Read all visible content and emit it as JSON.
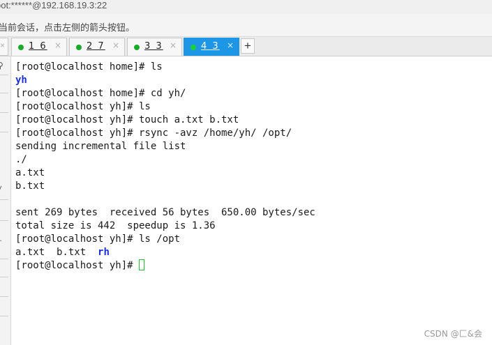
{
  "window": {
    "title": "oot:******@192.168.19.3:22"
  },
  "hint": {
    "text": "当前会话，点击左侧的箭头按钮。"
  },
  "tabs": [
    {
      "label": "1 6",
      "close": "×",
      "status_color": "#1aaa2a"
    },
    {
      "label": "2 7",
      "close": "×",
      "status_color": "#1aaa2a"
    },
    {
      "label": "3 3",
      "close": "×",
      "status_color": "#1aaa2a"
    },
    {
      "label": "4 3",
      "close": "×",
      "status_color": "#19d23a",
      "active": true
    }
  ],
  "tabbar": {
    "stub_close": "×",
    "add_label": "+"
  },
  "sidebar": {
    "search_icon": "search-icon",
    "search_glyph": "⚲",
    "chevron_glyph": "˅",
    "more_glyph": ":."
  },
  "terminal": {
    "lines": [
      {
        "text": "[root@localhost home]# ls"
      },
      {
        "text": "yh",
        "style": "dir"
      },
      {
        "text": "[root@localhost home]# cd yh/"
      },
      {
        "text": "[root@localhost yh]# ls"
      },
      {
        "text": "[root@localhost yh]# touch a.txt b.txt"
      },
      {
        "text": "[root@localhost yh]# rsync -avz /home/yh/ /opt/"
      },
      {
        "text": "sending incremental file list"
      },
      {
        "text": "./"
      },
      {
        "text": "a.txt"
      },
      {
        "text": "b.txt"
      },
      {
        "text": ""
      },
      {
        "text": "sent 269 bytes  received 56 bytes  650.00 bytes/sec"
      },
      {
        "text": "total size is 442  speedup is 1.36"
      },
      {
        "text": "[root@localhost yh]# ls /opt"
      },
      {
        "parts": [
          "a.txt  b.txt  ",
          "rh"
        ]
      },
      {
        "text": "[root@localhost yh]# "
      }
    ],
    "cursor_color": "#22c03a",
    "dir_color": "#1a2fd6"
  },
  "watermark": {
    "text": "CSDN @匚&会"
  }
}
